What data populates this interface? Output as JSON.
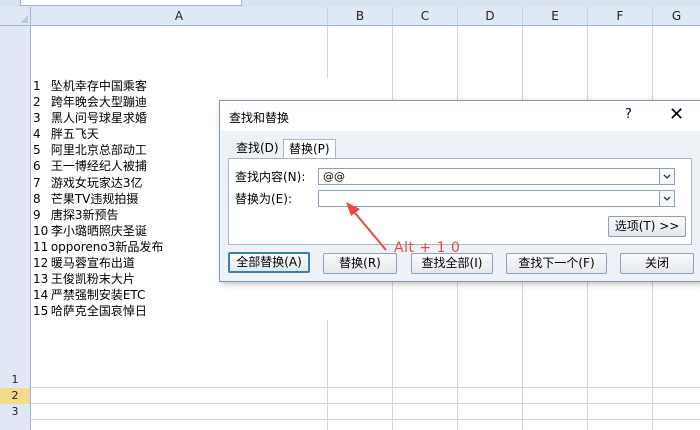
{
  "sheet": {
    "columns": [
      "A",
      "B",
      "C",
      "D",
      "E",
      "F",
      "G"
    ],
    "rows": [
      "1",
      "2",
      "3"
    ],
    "active_row": "2",
    "cell_a1_lines": [
      {
        "n": "1",
        "text": "坠机幸存中国乘客"
      },
      {
        "n": "2",
        "text": "跨年晚会大型蹦迪"
      },
      {
        "n": "3",
        "text": "黑人问号球星求婚"
      },
      {
        "n": "4",
        "text": "胖五飞天"
      },
      {
        "n": "5",
        "text": "阿里北京总部动工"
      },
      {
        "n": "6",
        "text": "王一博经纪人被捕"
      },
      {
        "n": "7",
        "text": "游戏女玩家达3亿"
      },
      {
        "n": "8",
        "text": "芒果TV违规拍摄"
      },
      {
        "n": "9",
        "text": "唐探3新预告"
      },
      {
        "n": "10",
        "text": "李小璐晒照庆圣诞"
      },
      {
        "n": "11",
        "text": "opporeno3新品发布"
      },
      {
        "n": "12",
        "text": "暖马蓉宣布出道"
      },
      {
        "n": "13",
        "text": "王俊凯粉末大片"
      },
      {
        "n": "14",
        "text": "严禁强制安装ETC"
      },
      {
        "n": "15",
        "text": "哈萨克全国哀悼日"
      }
    ]
  },
  "dialog": {
    "title": "查找和替换",
    "help": "?",
    "close": "✕",
    "tabs": {
      "find": "查找(D)",
      "replace": "替换(P)"
    },
    "find_label": "查找内容(N):",
    "find_value": "@@",
    "replace_label": "替换为(E):",
    "replace_value": "",
    "options_button": "选项(T) >>",
    "buttons": {
      "replace_all": "全部替换(A)",
      "replace": "替换(R)",
      "find_all": "查找全部(I)",
      "find_next": "查找下一个(F)",
      "close": "关闭"
    }
  },
  "annotation": {
    "text": "Alt + 1 0",
    "color": "#e54b4b"
  }
}
